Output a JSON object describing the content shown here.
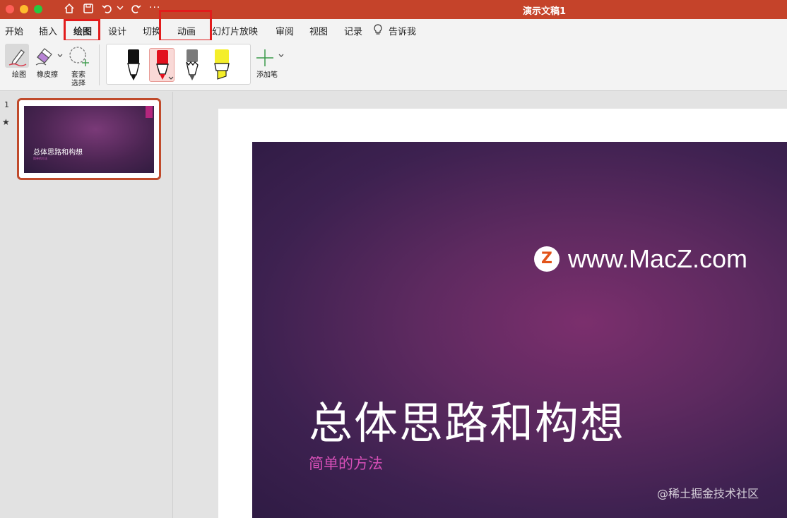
{
  "window": {
    "title": "演示文稿1",
    "toolbar_icons": [
      "home-icon",
      "save-icon",
      "undo-icon",
      "redo-icon",
      "more-icon"
    ],
    "more_label": "···"
  },
  "ribbon": {
    "tabs": [
      {
        "label": "开始"
      },
      {
        "label": "插入"
      },
      {
        "label": "绘图",
        "selected": true
      },
      {
        "label": "设计"
      },
      {
        "label": "切换"
      },
      {
        "label": "动画"
      },
      {
        "label": "幻灯片放映"
      },
      {
        "label": "审阅"
      },
      {
        "label": "视图"
      },
      {
        "label": "记录"
      },
      {
        "label": "告诉我"
      }
    ],
    "highlight_color": "#e21c1c",
    "tools": {
      "draw_label": "绘图",
      "eraser_label": "橡皮擦",
      "lasso_label_1": "套索",
      "lasso_label_2": "选择",
      "add_pen_label": "添加笔"
    },
    "pens": [
      {
        "name": "black-pen",
        "color": "#111111"
      },
      {
        "name": "red-pen",
        "color": "#e2101e",
        "selected": true
      },
      {
        "name": "gray-pencil",
        "color": "#7a7a7a"
      },
      {
        "name": "yellow-highlighter",
        "color": "#f4ee2a"
      }
    ]
  },
  "thumbnails": {
    "slide_number": "1",
    "star_label": "★",
    "thumb_title": "总体思路和构想",
    "thumb_subtitle": "简单的方法"
  },
  "slide": {
    "title": "总体思路和构想",
    "subtitle": "简单的方法",
    "title_color": "#ffffff",
    "subtitle_color": "#d64fb7"
  },
  "watermark": {
    "logo_letter": "Z",
    "site": "www.MacZ.com",
    "footer": "@稀土掘金技术社区"
  }
}
